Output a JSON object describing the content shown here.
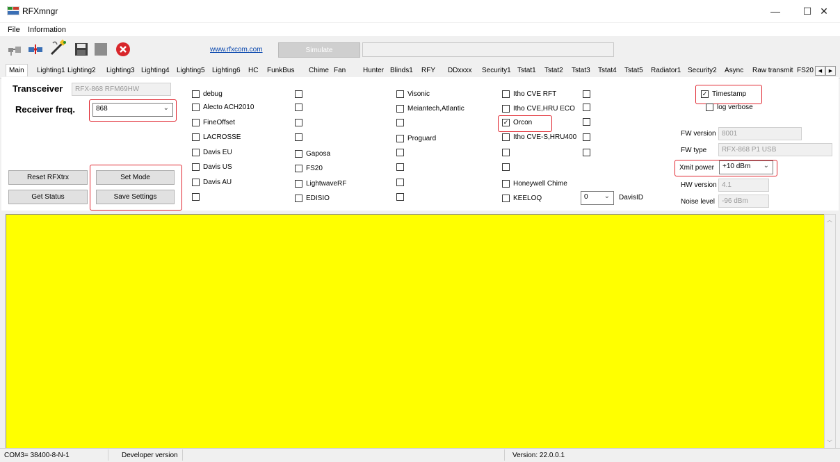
{
  "window": {
    "title": "RFXmngr",
    "minimize": "—",
    "maximize": "☐",
    "close": "✕"
  },
  "menu": {
    "file": "File",
    "information": "Information"
  },
  "toolbar": {
    "link": "www.rfxcom.com",
    "simulate": "Simulate"
  },
  "tabs": [
    "Main",
    "Lighting1",
    "Lighting2",
    "Lighting3",
    "Lighting4",
    "Lighting5",
    "Lighting6",
    "HC",
    "FunkBus",
    "Chime",
    "Fan",
    "Hunter",
    "Blinds1",
    "RFY",
    "DDxxxx",
    "Security1",
    "Tstat1",
    "Tstat2",
    "Tstat3",
    "Tstat4",
    "Tstat5",
    "Radiator1",
    "Security2",
    "Async",
    "Raw transmit",
    "FS20"
  ],
  "main": {
    "transceiver_label": "Transceiver",
    "transceiver_value": "RFX-868 RFM69HW",
    "receiver_label": "Receiver freq.",
    "receiver_value": "868",
    "reset_btn": "Reset RFXtrx",
    "set_mode_btn": "Set Mode",
    "get_status_btn": "Get Status",
    "save_settings_btn": "Save Settings"
  },
  "protocols": {
    "col1": [
      "debug",
      "Alecto ACH2010",
      "FineOffset",
      "LACROSSE",
      "Davis EU",
      "Davis US",
      "Davis AU",
      ""
    ],
    "col2": [
      "",
      "",
      "",
      "",
      "Gaposa",
      "FS20",
      "LightwaveRF",
      "EDISIO"
    ],
    "col3": [
      "Visonic",
      "Meiantech,Atlantic",
      "",
      "Proguard",
      "",
      "",
      "",
      ""
    ],
    "col4": [
      "Itho CVE RFT",
      "Itho CVE,HRU ECO",
      "Orcon",
      "Itho CVE-S,HRU400",
      "",
      "",
      "Honeywell Chime",
      "KEELOQ"
    ],
    "col5": [
      "",
      "",
      "",
      "",
      ""
    ],
    "checked": [
      "Orcon"
    ]
  },
  "davis": {
    "value": "0",
    "label": "DavisID"
  },
  "right": {
    "timestamp_label": "Timestamp",
    "timestamp_checked": true,
    "log_verbose_label": "log verbose",
    "fw_version_label": "FW version",
    "fw_version_value": "8001",
    "fw_type_label": "FW type",
    "fw_type_value": "RFX-868 P1 USB",
    "xmit_power_label": "Xmit power",
    "xmit_power_value": "+10 dBm",
    "hw_version_label": "HW version",
    "hw_version_value": "4.1",
    "noise_level_label": "Noise level",
    "noise_level_value": "-96 dBm"
  },
  "status": {
    "port": "COM3= 38400-8-N-1",
    "edition": "Developer version",
    "version": "Version: 22.0.0.1"
  },
  "colors": {
    "log_bg": "#ffff00",
    "highlight": "#e0252e"
  }
}
